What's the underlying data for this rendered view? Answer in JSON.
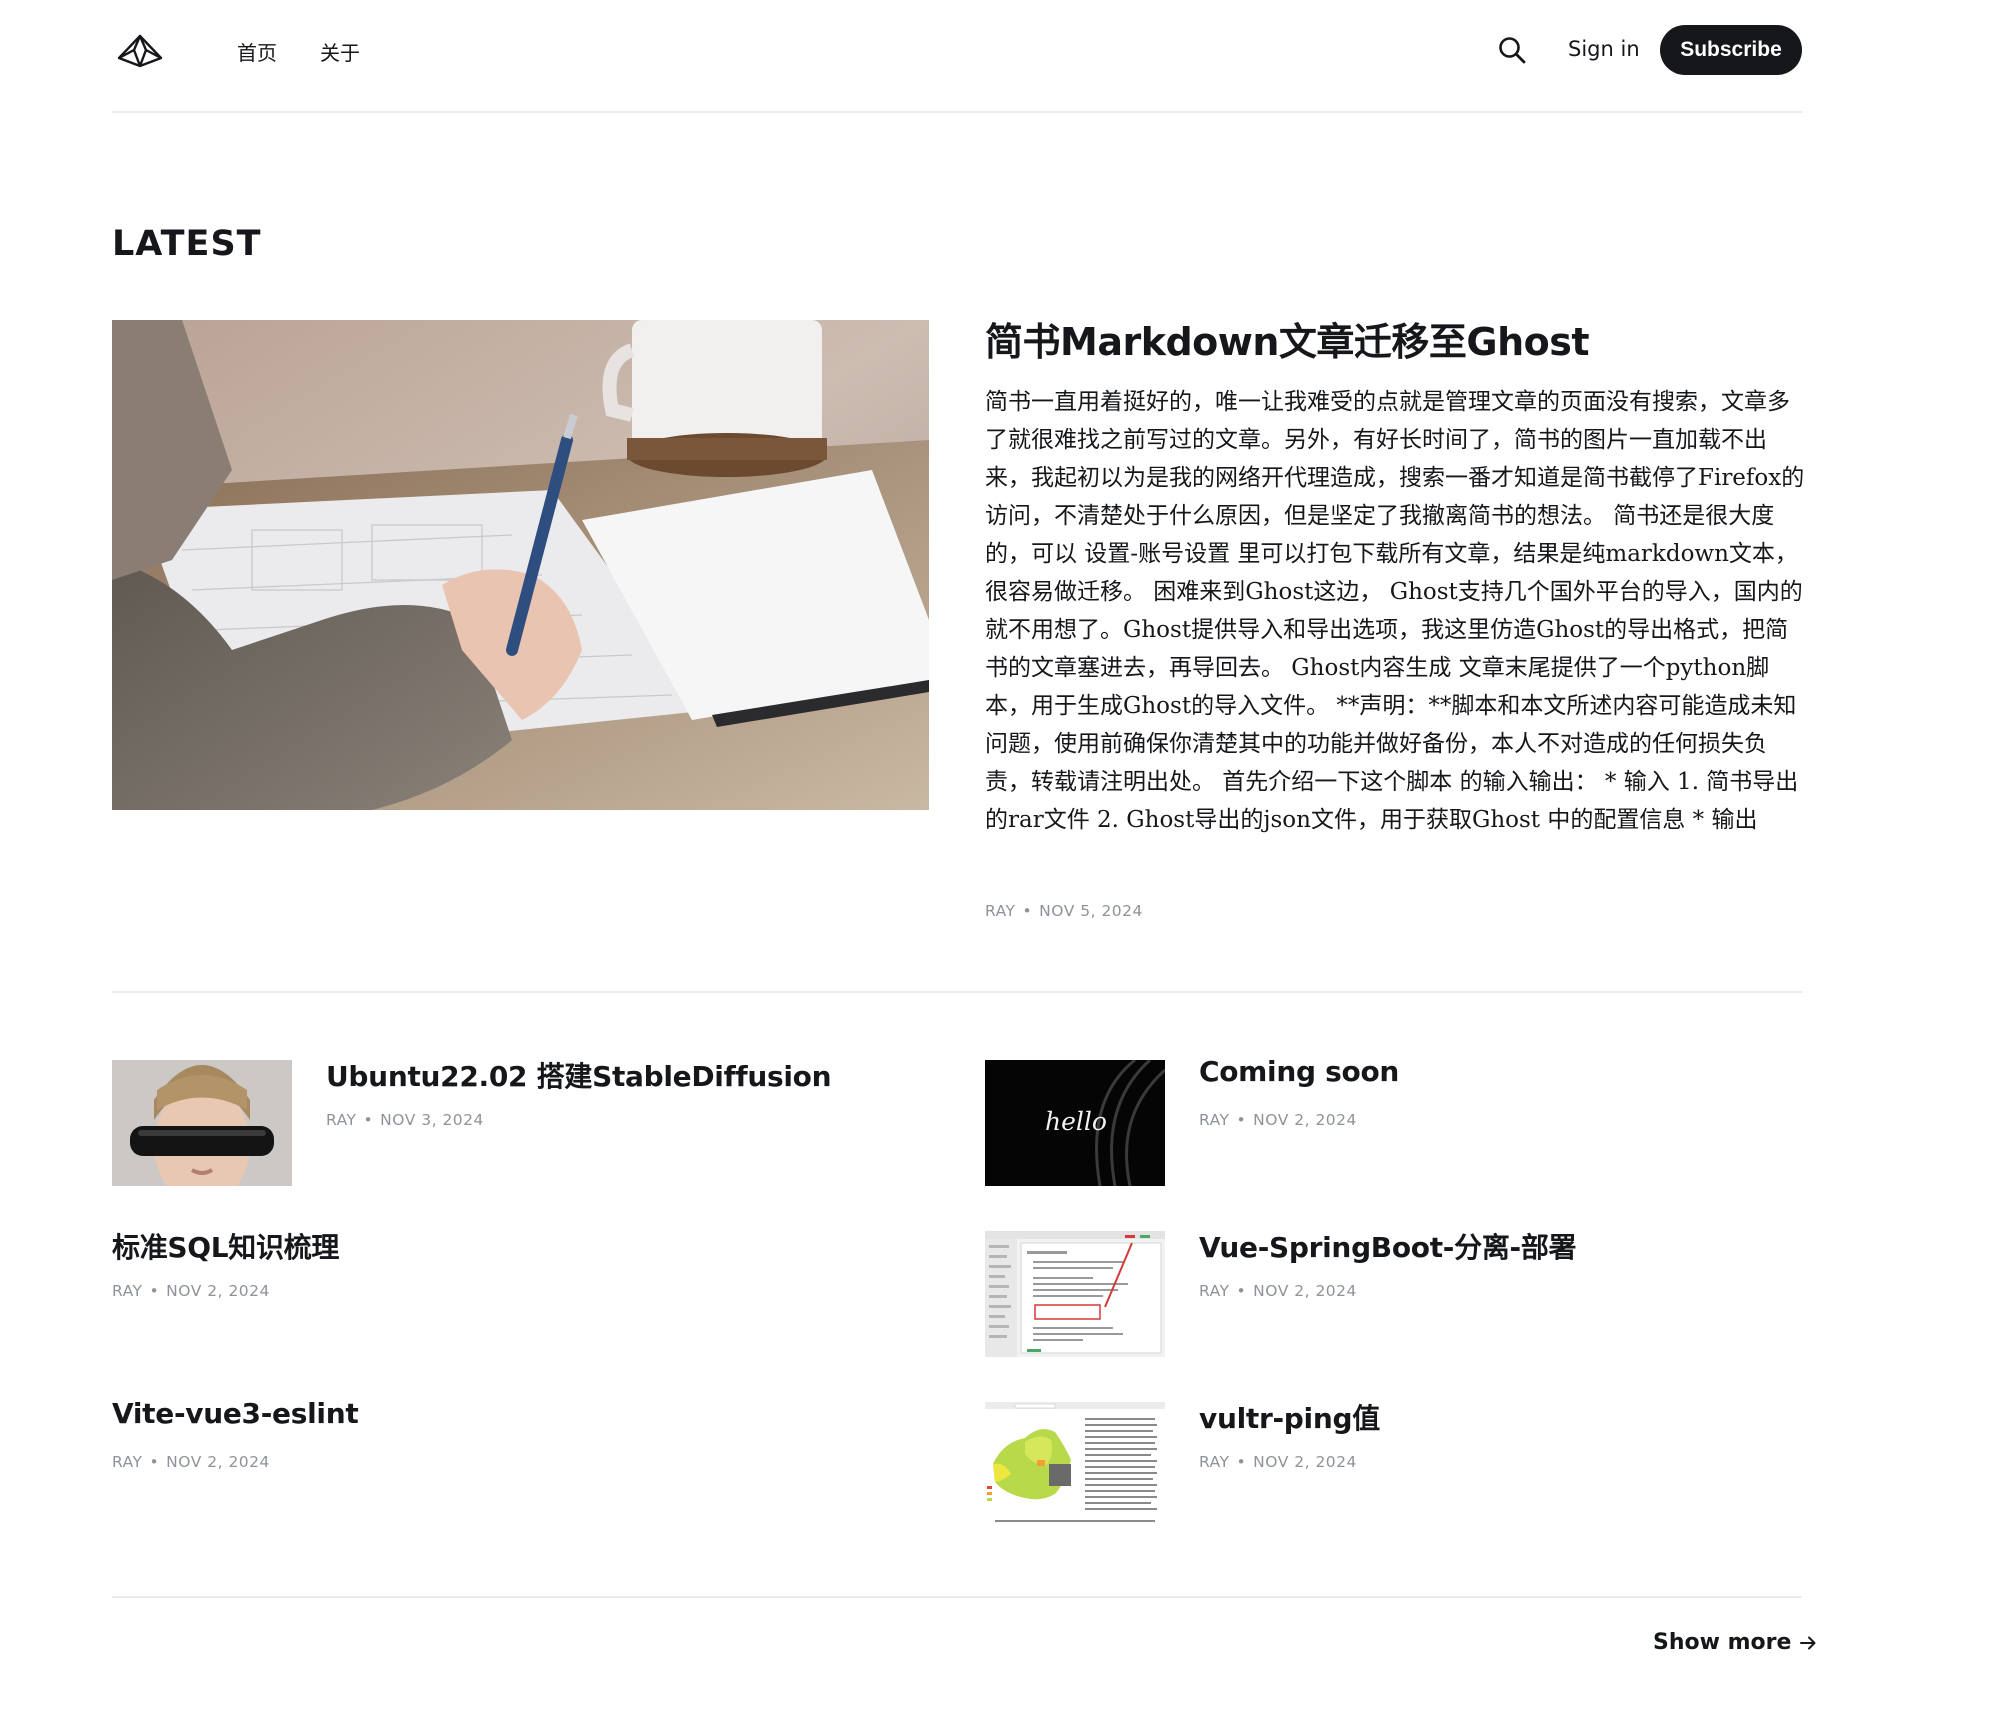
{
  "header": {
    "nav": [
      {
        "label": "首页"
      },
      {
        "label": "关于"
      }
    ],
    "sign_in": "Sign in",
    "subscribe": "Subscribe"
  },
  "latest": {
    "section_title": "LATEST",
    "featured": {
      "title": "简书Markdown文章迁移至Ghost",
      "excerpt": "简书一直用着挺好的，唯一让我难受的点就是管理文章的页面没有搜索，文章多了就很难找之前写过的文章。另外，有好长时间了，简书的图片一直加载不出来，我起初以为是我的网络开代理造成，搜索一番才知道是简书截停了Firefox的访问，不清楚处于什么原因，但是坚定了我撤离简书的想法。 简书还是很大度的，可以 设置-账号设置 里可以打包下载所有文章，结果是纯markdown文本，很容易做迁移。 困难来到Ghost这边， Ghost支持几个国外平台的导入，国内的就不用想了。Ghost提供导入和导出选项，我这里仿造Ghost的导出格式，把简书的文章塞进去，再导回去。 Ghost内容生成 文章末尾提供了一个python脚本，用于生成Ghost的导入文件。 **声明：**脚本和本文所述内容可能造成未知问题，使用前确保你清楚其中的功能并做好备份，本人不对造成的任何损失负责，转载请注明出处。 首先介绍一下这个脚本 的输入输出： * 输入 1. 简书导出的rar文件 2. Ghost导出的json文件，用于获取Ghost 中的配置信息 * 输出",
      "author": "RAY",
      "date": "NOV 5, 2024"
    },
    "posts": [
      {
        "title": "Ubuntu22.02 搭建StableDiffusion",
        "author": "RAY",
        "date": "NOV 3, 2024"
      },
      {
        "title": "Coming soon",
        "author": "RAY",
        "date": "NOV 2, 2024",
        "thumb_text": "hello"
      },
      {
        "title": "标准SQL知识梳理",
        "author": "RAY",
        "date": "NOV 2, 2024"
      },
      {
        "title": "Vue-SpringBoot-分离-部署",
        "author": "RAY",
        "date": "NOV 2, 2024"
      },
      {
        "title": "Vite-vue3-eslint",
        "author": "RAY",
        "date": "NOV 2, 2024"
      },
      {
        "title": "vultr-ping值",
        "author": "RAY",
        "date": "NOV 2, 2024"
      }
    ],
    "show_more": "Show more"
  },
  "colors": {
    "text": "#15171a",
    "meta": "#8e9399",
    "divider": "#e9ebed",
    "button_bg": "#15171a"
  }
}
